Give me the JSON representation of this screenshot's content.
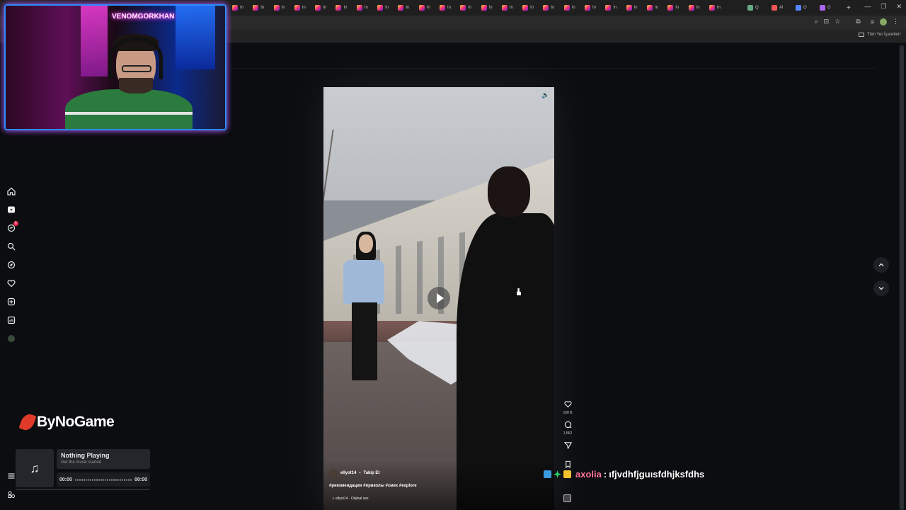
{
  "browser": {
    "tab_label": "In",
    "extra_tabs": [
      "Q",
      "Al",
      "O",
      "G"
    ],
    "bookmarks_label": "Tüm Yer İşaretleri",
    "window_controls": [
      "—",
      "❐",
      "✕"
    ],
    "new_tab": "+"
  },
  "webcam": {
    "neon_sign": "VENOMGORKHAN"
  },
  "sidebar": {
    "items": [
      {
        "name": "home-icon"
      },
      {
        "name": "reels-icon"
      },
      {
        "name": "messages-icon",
        "badge": "1"
      },
      {
        "name": "search-icon"
      },
      {
        "name": "explore-icon"
      },
      {
        "name": "heart-icon"
      },
      {
        "name": "create-icon"
      },
      {
        "name": "dashboard-icon"
      },
      {
        "name": "profile-avatar"
      }
    ],
    "bottom": [
      "menu-icon",
      "more-icon"
    ]
  },
  "overlay": {
    "brand": "ByNoGame",
    "music": {
      "title": "Nothing Playing",
      "subtitle": "Get the music started",
      "time_start": "00:00",
      "time_end": "00:00",
      "icon": "♫"
    },
    "chat": {
      "username": "axolia",
      "separator": ":",
      "message": "ıfjvdhfjguısfdhjksfdhs"
    }
  },
  "reel": {
    "author": "ellyot14",
    "dot": "•",
    "follow_label": "Takip Et",
    "hashtags": "#рекомендации #приколы #смех #explore",
    "audio": "♫ ellyot14 · Orijinal ses",
    "mute_icon": "🔈"
  },
  "actions": {
    "likes": "100 B",
    "comments": "1.552"
  },
  "colors": {
    "accent_pink": "#ff3df0",
    "accent_blue": "#2a8cff",
    "chat_user": "#ff7a9e",
    "brand_red": "#e03a2a"
  }
}
